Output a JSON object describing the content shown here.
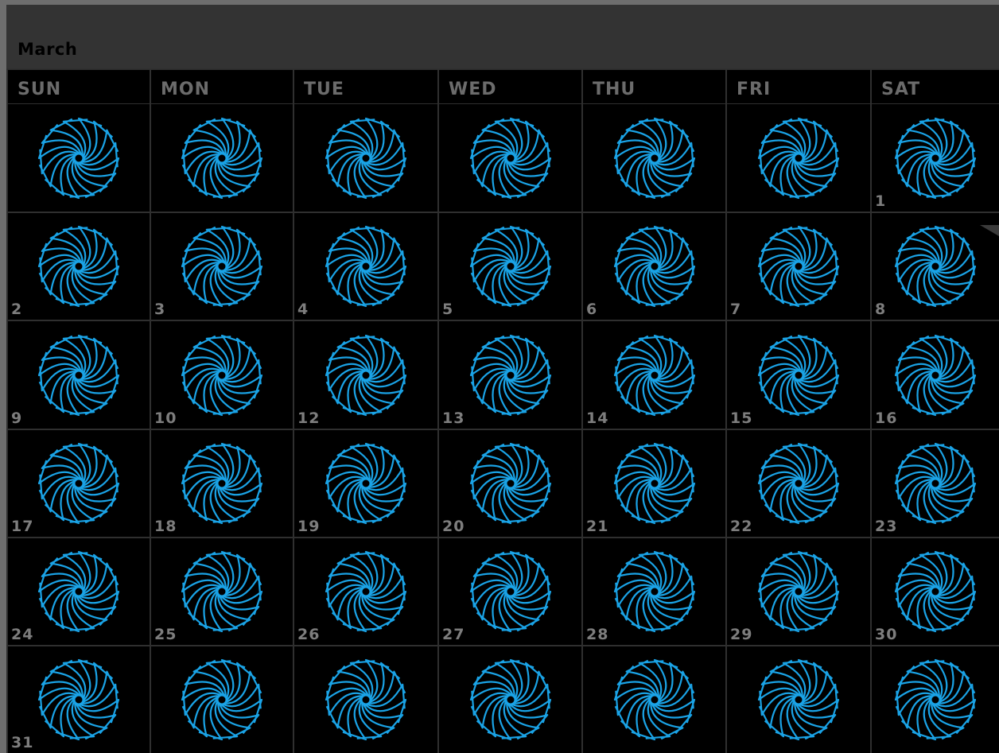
{
  "calendar": {
    "month": "March",
    "weekdays": [
      "SUN",
      "MON",
      "TUE",
      "WED",
      "THU",
      "FRI",
      "SAT"
    ],
    "icon": "spiral-pinwheel-icon",
    "icon_color": "#1aa3e6",
    "weeks": [
      [
        "",
        "",
        "",
        "",
        "",
        "",
        "1"
      ],
      [
        "2",
        "3",
        "4",
        "5",
        "6",
        "7",
        "8"
      ],
      [
        "9",
        "10",
        "12",
        "13",
        "14",
        "15",
        "16"
      ],
      [
        "17",
        "18",
        "19",
        "20",
        "21",
        "22",
        "23"
      ],
      [
        "24",
        "25",
        "26",
        "27",
        "28",
        "29",
        "30"
      ],
      [
        "31",
        "",
        "",
        "",
        "",
        "",
        ""
      ]
    ]
  }
}
